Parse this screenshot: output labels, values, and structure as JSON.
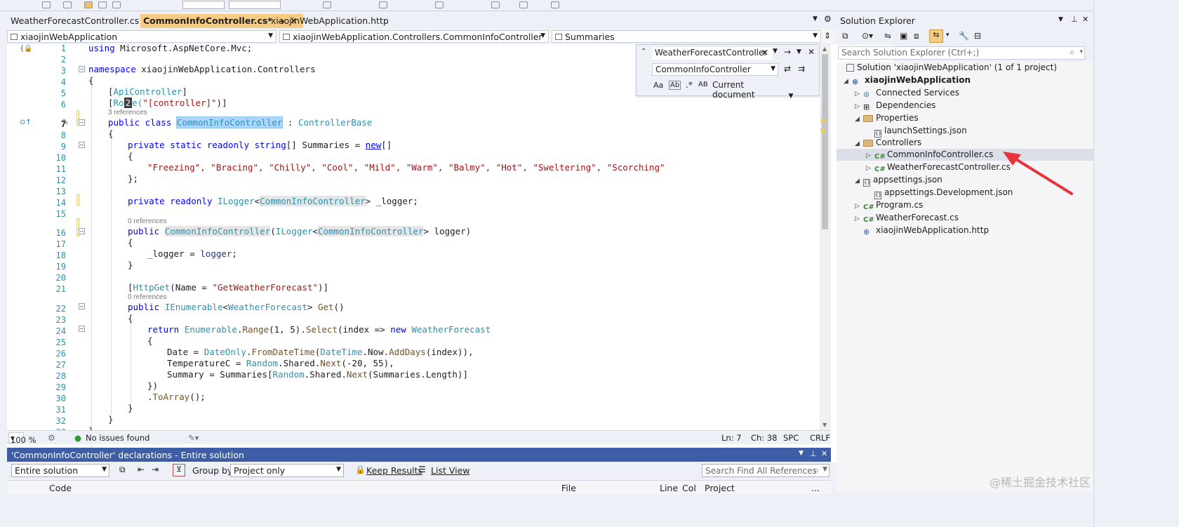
{
  "tabs": [
    {
      "label": "WeatherForecastController.cs",
      "active": false
    },
    {
      "label": "CommonInfoController.cs*",
      "active": true
    },
    {
      "label": "xiaojinWebApplication.http",
      "active": false
    }
  ],
  "nav": {
    "project": "xiaojinWebApplication",
    "type": "xiaojinWebApplication.Controllers.CommonInfoController",
    "member": "Summaries"
  },
  "code": {
    "line_numbers": [
      "1",
      "2",
      "3",
      "4",
      "5",
      "6",
      "7",
      "8",
      "9",
      "10",
      "11",
      "12",
      "13",
      "14",
      "15",
      "16",
      "17",
      "18",
      "19",
      "20",
      "21",
      "22",
      "23",
      "24",
      "25",
      "26",
      "27",
      "28",
      "29",
      "30",
      "31",
      "32",
      "33"
    ],
    "line1_kw": "using",
    "line1_rest": " Microsoft.AspNetCore.Mvc;",
    "line3_kw": "namespace",
    "line3_rest": " xiaojinWebApplication.Controllers",
    "brace_open": "{",
    "brace_close": "}",
    "line5_open": "[",
    "line5_type": "ApiController",
    "line5_close": "]",
    "line6_open": "[",
    "line6_a": "Ro",
    "line6_badge": "2",
    "line6_b": "e(",
    "line6_str": "\"[controller]\"",
    "line6_close": ")]",
    "lens_3refs": "3 references",
    "line7_kw": "public class ",
    "line7_name": "CommonInfoController",
    "line7_sep": " : ",
    "line7_base": "ControllerBase",
    "line9_kw": "private static readonly string",
    "line9_rest": "[] Summaries = ",
    "line9_new": "new",
    "line9_end": "[]",
    "line11_values": "\"Freezing\", \"Bracing\", \"Chilly\", \"Cool\", \"Mild\", \"Warm\", \"Balmy\", \"Hot\", \"Sweltering\", \"Scorching\"",
    "line12": "};",
    "line14_kw": "private readonly ",
    "line14_type": "ILogger",
    "line14_lt": "<",
    "line14_gen": "CommonInfoController",
    "line14_rest": "> _logger;",
    "lens_0refs": "0 references",
    "line16_kw": "public ",
    "line16_name": "CommonInfoController",
    "line16_p": "(",
    "line16_type": "ILogger",
    "line16_lt": "<",
    "line16_gen": "CommonInfoController",
    "line16_rest": "> logger)",
    "line18_a": "_logger = ",
    "line18_b": "logger",
    "line18_c": ";",
    "line21_open": "[",
    "line21_type": "HttpGet",
    "line21_a": "(Name = ",
    "line21_str": "\"GetWeatherForecast\"",
    "line21_close": ")]",
    "line22_kw": "public ",
    "line22_type": "IEnumerable",
    "line22_lt": "<",
    "line22_gen": "WeatherForecast",
    "line22_gt": "> ",
    "line22_m": "Get",
    "line22_end": "()",
    "line24_kw": "return ",
    "line24_type": "Enumerable",
    "line24_dot": ".",
    "line24_m1": "Range",
    "line24_a": "(1, 5).",
    "line24_m2": "Select",
    "line24_b": "(index => ",
    "line24_new": "new ",
    "line24_t2": "WeatherForecast",
    "line26_a": "Date = ",
    "line26_t": "DateOnly",
    "line26_dot": ".",
    "line26_m": "FromDateTime",
    "line26_p": "(",
    "line26_t2": "DateTime",
    "line26_b": ".Now.",
    "line26_m2": "AddDays",
    "line26_c": "(index)),",
    "line27_a": "TemperatureC = ",
    "line27_t": "Random",
    "line27_b": ".Shared.",
    "line27_m": "Next",
    "line27_c": "(-20, 55),",
    "line28_a": "Summary = Summaries[",
    "line28_t": "Random",
    "line28_b": ".Shared.",
    "line28_m": "Next",
    "line28_c": "(Summaries.Length)]",
    "line29": "})",
    "line30_dot": ".",
    "line30_m": "ToArray",
    "line30_end": "();"
  },
  "find": {
    "search_text": "WeatherForecastController",
    "replace_text": "CommonInfoController",
    "scope": "Current document",
    "opt_case": "Aa",
    "opt_word": "Ab",
    "opt_ab": "AB"
  },
  "status": {
    "zoom": "100 %",
    "issues": "No issues found",
    "line": "Ln: 7",
    "col": "Ch: 38",
    "spc": "SPC",
    "eol": "CRLF"
  },
  "refs": {
    "title": "'CommonInfoController' declarations - Entire solution",
    "scope": "Entire solution",
    "group_by_label": "Group by:",
    "group_by_value": "Project only",
    "keep_results": "Keep Results",
    "list_view": "List View",
    "search_placeholder": "Search Find All References",
    "columns": [
      "Code",
      "File",
      "Line",
      "Col",
      "Project",
      "..."
    ]
  },
  "solution_explorer": {
    "title": "Solution Explorer",
    "search_placeholder": "Search Solution Explorer (Ctrl+;)",
    "nodes": [
      {
        "label": "Solution 'xiaojinWebApplication' (1 of 1 project)",
        "icon": "solution-icon"
      },
      {
        "label": "xiaojinWebApplication",
        "icon": "project-icon"
      },
      {
        "label": "Connected Services",
        "icon": "connected-services-icon"
      },
      {
        "label": "Dependencies",
        "icon": "dependencies-icon"
      },
      {
        "label": "Properties",
        "icon": "folder-icon"
      },
      {
        "label": "launchSettings.json",
        "icon": "json-file-icon"
      },
      {
        "label": "Controllers",
        "icon": "folder-icon"
      },
      {
        "label": "CommonInfoController.cs",
        "icon": "csharp-file-icon"
      },
      {
        "label": "WeatherForecastController.cs",
        "icon": "csharp-file-icon"
      },
      {
        "label": "appsettings.json",
        "icon": "json-file-icon"
      },
      {
        "label": "appsettings.Development.json",
        "icon": "json-file-icon"
      },
      {
        "label": "Program.cs",
        "icon": "csharp-file-icon"
      },
      {
        "label": "WeatherForecast.cs",
        "icon": "csharp-file-icon"
      },
      {
        "label": "xiaojinWebApplication.http",
        "icon": "http-file-icon"
      }
    ],
    "cs_glyph": "C#",
    "json_glyph": "{}"
  },
  "watermark": "@稀土掘金技术社区",
  "colors": {
    "accent": "#3d5ea6",
    "active_tab": "#f5cc84",
    "arrow": "#e8333a",
    "keyword": "#0000ff",
    "type": "#2b91af",
    "string": "#a31515"
  }
}
